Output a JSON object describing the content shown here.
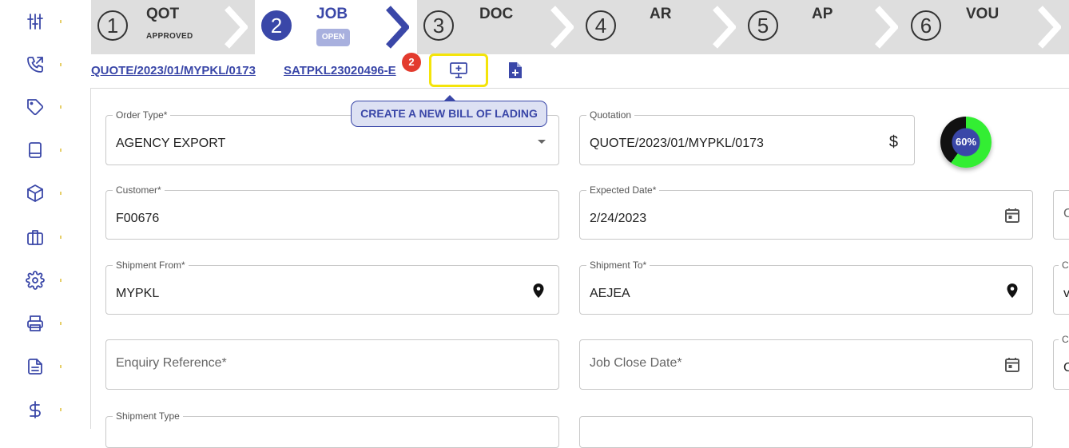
{
  "stepper": {
    "steps": [
      {
        "number": "1",
        "label": "QOT",
        "sub": "APPROVED"
      },
      {
        "number": "2",
        "label": "JOB",
        "badge": "OPEN"
      },
      {
        "number": "3",
        "label": "DOC"
      },
      {
        "number": "4",
        "label": "AR"
      },
      {
        "number": "5",
        "label": "AP"
      },
      {
        "number": "6",
        "label": "VOU"
      }
    ]
  },
  "links": {
    "quotation_ref": "QUOTE/2023/01/MYPKL/0173",
    "job_ref": "SATPKL23020496-E",
    "notification_count": "2",
    "tooltip": "CREATE A NEW BILL OF LADING"
  },
  "form": {
    "order_type": {
      "label": "Order Type*",
      "value": "AGENCY EXPORT"
    },
    "quotation": {
      "label": "Quotation",
      "value": "QUOTE/2023/01/MYPKL/0173",
      "icon_glyph": "$"
    },
    "progress": {
      "value": 60,
      "text": "60%"
    },
    "customer": {
      "label": "Customer*",
      "value": "F00676"
    },
    "expected_date": {
      "label": "Expected Date*",
      "value": "2/24/2023"
    },
    "shipment_from": {
      "label": "Shipment From*",
      "value": "MYPKL"
    },
    "shipment_to": {
      "label": "Shipment To*",
      "value": "AEJEA"
    },
    "enquiry_reference": {
      "placeholder": "Enquiry Reference*"
    },
    "job_close_date": {
      "placeholder": "Job Close Date*"
    },
    "shipment_type": {
      "label": "Shipment Type"
    },
    "right_column_edge": {
      "r2": "C",
      "r3_label": "C",
      "r3_value": "v",
      "r4_label": "C",
      "r4_value": "C"
    }
  },
  "colors": {
    "accent": "#3a47a8",
    "highlight": "#f4e40a",
    "badge_red": "#e33b2e",
    "progress_green": "#33ee33"
  },
  "icons": [
    "sliders-icon",
    "phone-icon",
    "tag-icon",
    "book-icon",
    "package-icon",
    "briefcase-icon",
    "gear-icon",
    "printer-icon",
    "document-icon",
    "dollar-icon"
  ]
}
